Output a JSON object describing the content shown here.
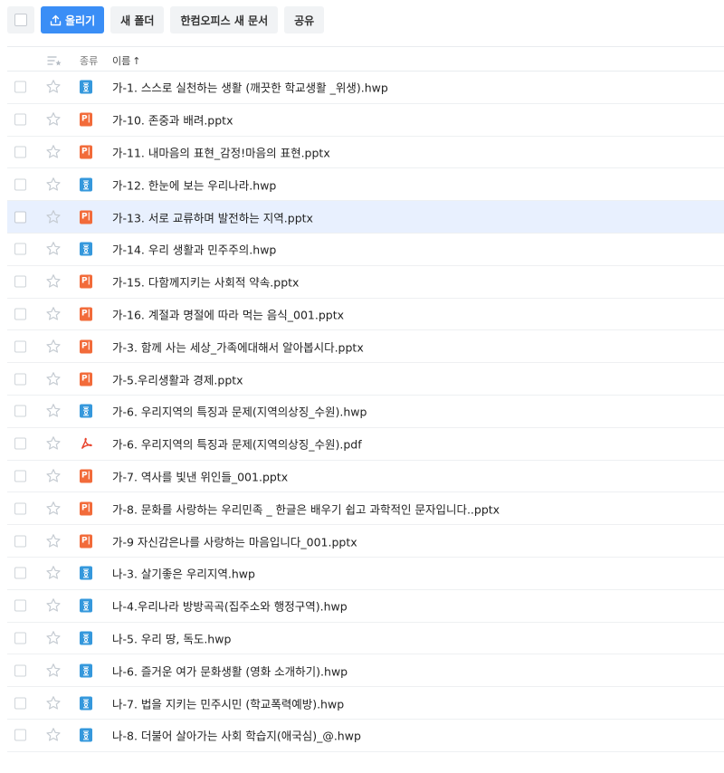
{
  "toolbar": {
    "upload_label": "올리기",
    "new_folder_label": "새 폴더",
    "new_doc_label": "한컴오피스 새 문서",
    "share_label": "공유"
  },
  "header": {
    "type_label": "종류",
    "name_label": "이름",
    "sort_arrow": "↑"
  },
  "colors": {
    "primary": "#3a8ef6",
    "hwp": "#3598dc",
    "pptx": "#f26b3a",
    "pdf": "#e8432c",
    "selected_row": "#e8f0fe"
  },
  "files": [
    {
      "name": "가-1. 스스로 실천하는 생활 (깨끗한 학교생활 _위생).hwp",
      "type": "hwp"
    },
    {
      "name": "가-10. 존중과 배려.pptx",
      "type": "pptx"
    },
    {
      "name": "가-11. 내마음의 표현_감정!마음의 표현.pptx",
      "type": "pptx"
    },
    {
      "name": "가-12. 한눈에 보는 우리나라.hwp",
      "type": "hwp"
    },
    {
      "name": "가-13. 서로 교류하며 발전하는 지역.pptx",
      "type": "pptx",
      "selected": true
    },
    {
      "name": "가-14. 우리 생활과 민주주의.hwp",
      "type": "hwp"
    },
    {
      "name": "가-15. 다함께지키는 사회적 약속.pptx",
      "type": "pptx"
    },
    {
      "name": "가-16. 계절과 명절에 따라 먹는 음식_001.pptx",
      "type": "pptx"
    },
    {
      "name": "가-3. 함께 사는 세상_가족에대해서 알아봅시다.pptx",
      "type": "pptx"
    },
    {
      "name": "가-5.우리생활과 경제.pptx",
      "type": "pptx"
    },
    {
      "name": "가-6. 우리지역의 특징과 문제(지역의상징_수원).hwp",
      "type": "hwp"
    },
    {
      "name": "가-6. 우리지역의 특징과 문제(지역의상징_수원).pdf",
      "type": "pdf"
    },
    {
      "name": "가-7. 역사를 빛낸 위인들_001.pptx",
      "type": "pptx"
    },
    {
      "name": "가-8. 문화를 사랑하는 우리민족 _ 한글은 배우기 쉽고 과학적인 문자입니다..pptx",
      "type": "pptx"
    },
    {
      "name": "가-9 자신감은나를 사랑하는 마음입니다_001.pptx",
      "type": "pptx"
    },
    {
      "name": "나-3. 살기좋은 우리지역.hwp",
      "type": "hwp"
    },
    {
      "name": "나-4.우리나라 방방곡곡(집주소와 행정구역).hwp",
      "type": "hwp"
    },
    {
      "name": "나-5. 우리 땅, 독도.hwp",
      "type": "hwp"
    },
    {
      "name": "나-6. 즐거운 여가 문화생활 (영화 소개하기).hwp",
      "type": "hwp"
    },
    {
      "name": "나-7. 법을 지키는 민주시민 (학교폭력예방).hwp",
      "type": "hwp"
    },
    {
      "name": "나-8. 더불어 살아가는 사회 학습지(애국심)_@.hwp",
      "type": "hwp"
    }
  ]
}
